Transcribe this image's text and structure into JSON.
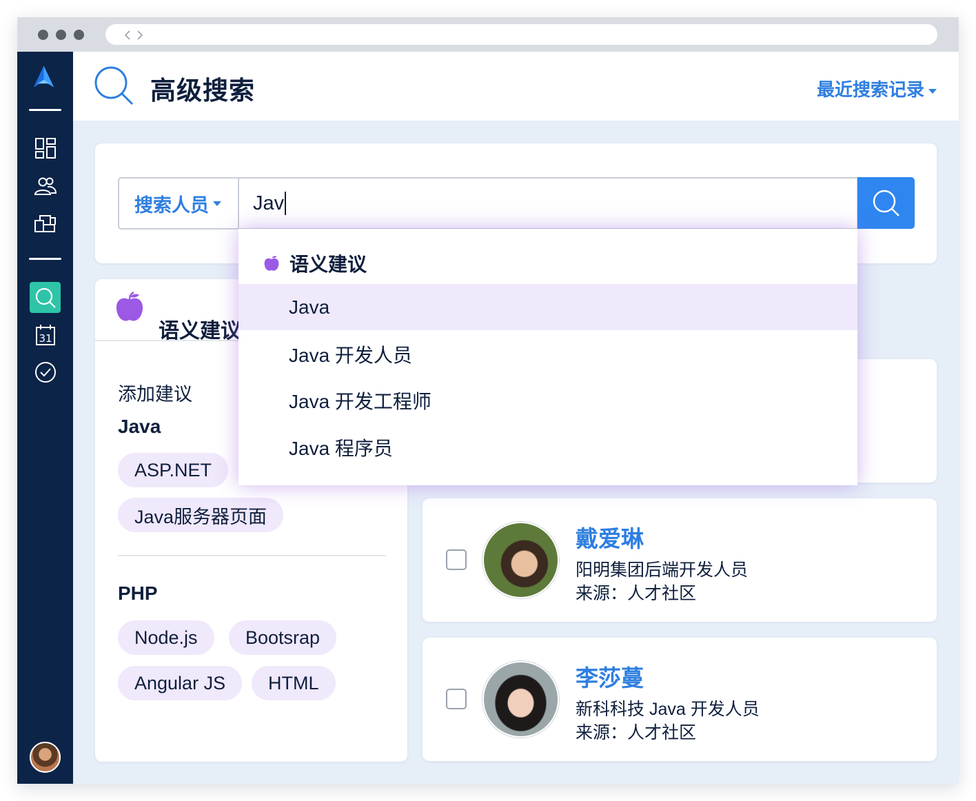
{
  "browser": {
    "nav_glyph": "< >"
  },
  "sidebar": {
    "items": [
      {
        "icon": "dashboard-icon"
      },
      {
        "icon": "users-icon"
      },
      {
        "icon": "folders-icon"
      },
      {
        "icon": "search-icon",
        "active": true
      },
      {
        "icon": "calendar-icon",
        "calendar_day": "31"
      },
      {
        "icon": "check-circle-icon"
      }
    ]
  },
  "header": {
    "title": "高级搜索",
    "recent_label": "最近搜索记录"
  },
  "search": {
    "scope_label": "搜索人员",
    "query": "Jav"
  },
  "autocomplete": {
    "heading": "语义建议",
    "items": [
      "Java",
      "Java 开发人员",
      "Java 开发工程师",
      "Java 程序员"
    ],
    "highlighted_index": 0
  },
  "suggestions_panel": {
    "title": "语义建议",
    "add_label": "添加建议",
    "groups": [
      {
        "name": "Java",
        "chips": [
          "ASP.NET",
          "Java服务器页面"
        ]
      },
      {
        "name": "PHP",
        "chips": [
          "Node.js",
          "Bootsrap",
          "Angular JS",
          "HTML"
        ]
      }
    ]
  },
  "results": [
    {
      "name": "戴爱琳",
      "title": "阳明集团后端开发人员",
      "source": "来源：人才社区"
    },
    {
      "name": "李莎蔓",
      "title": "新科科技 Java 开发人员",
      "source": "来源：人才社区"
    }
  ],
  "colors": {
    "sidebar_bg": "#0b2447",
    "accent_blue": "#2f7fe0",
    "active_green": "#2ec4a8",
    "suggestion_purple": "#9b59e6",
    "chip_bg": "#f0e8fb"
  }
}
